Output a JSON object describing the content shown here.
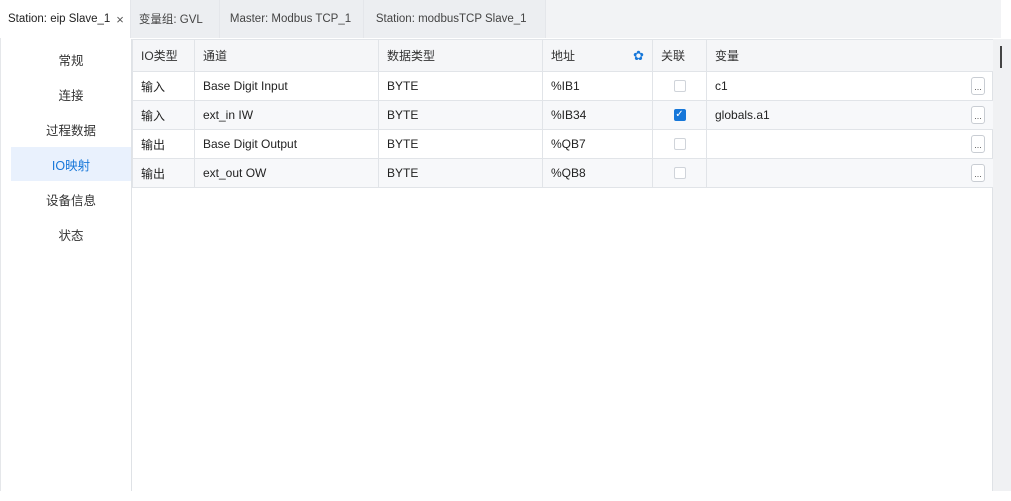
{
  "tabs": [
    {
      "label": "Station: eip Slave_1",
      "active": true,
      "closable": true
    },
    {
      "label": "变量组: GVL",
      "active": false
    },
    {
      "label": "Master: Modbus TCP_1",
      "active": false
    },
    {
      "label": "Station: modbusTCP Slave_1",
      "active": false
    }
  ],
  "close_glyph": "×",
  "sidebar": {
    "items": [
      {
        "label": "常规"
      },
      {
        "label": "连接"
      },
      {
        "label": "过程数据"
      },
      {
        "label": "IO映射",
        "active": true
      },
      {
        "label": "设备信息"
      },
      {
        "label": "状态"
      }
    ]
  },
  "table": {
    "headers": {
      "io_type": "IO类型",
      "channel": "通道",
      "data_type": "数据类型",
      "address": "地址",
      "linked": "关联",
      "variable": "变量"
    },
    "rows": [
      {
        "io_type": "输入",
        "channel": "Base Digit Input",
        "data_type": "BYTE",
        "address": "%IB1",
        "linked": false,
        "variable": "c1"
      },
      {
        "io_type": "输入",
        "channel": "ext_in IW",
        "data_type": "BYTE",
        "address": "%IB34",
        "linked": true,
        "variable": "globals.a1"
      },
      {
        "io_type": "输出",
        "channel": "Base Digit Output",
        "data_type": "BYTE",
        "address": "%QB7",
        "linked": false,
        "variable": ""
      },
      {
        "io_type": "输出",
        "channel": "ext_out OW",
        "data_type": "BYTE",
        "address": "%QB8",
        "linked": false,
        "variable": ""
      }
    ],
    "browse_label": "..."
  },
  "icons": {
    "settings": "gear-icon",
    "checkmark": "check-icon"
  },
  "colors": {
    "accent": "#1677d9",
    "active_bg": "#e9f1fd"
  }
}
